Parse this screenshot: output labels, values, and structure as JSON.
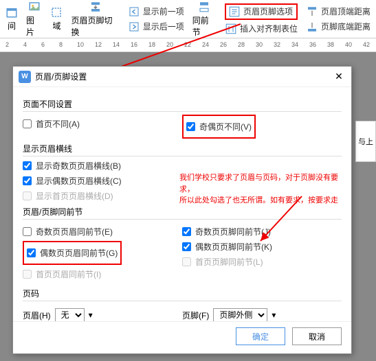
{
  "ribbon": {
    "g1": "间",
    "g2": "图片",
    "g3": "域",
    "g4": "页眉页脚切换",
    "g5a": "显示前一项",
    "g5b": "显示后一项",
    "g6": "同前节",
    "g7a": "页眉页脚选项",
    "g7b": "插入对齐制表位",
    "g8a": "页眉顶端距离",
    "g8b": "页脚底端距离"
  },
  "ruler": {
    "marks": [
      "2",
      "4",
      "6",
      "8",
      "10",
      "12",
      "14",
      "16",
      "18",
      "20",
      "22",
      "24",
      "26",
      "28",
      "30",
      "32",
      "34",
      "36",
      "38",
      "40",
      "42"
    ]
  },
  "side": "与上",
  "dialog": {
    "title": "页眉/页脚设置",
    "sec1": "页面不同设置",
    "chk_first": "首页不同(A)",
    "chk_oddeven": "奇偶页不同(V)",
    "sec2": "显示页眉横线",
    "chk_oddline": "显示奇数页页眉横线(B)",
    "chk_evenline": "显示偶数页页眉横线(C)",
    "chk_firstline": "显示首页页眉横线(D)",
    "sec3": "页眉/页脚同前节",
    "chk_e": "奇数页页眉同前节(E)",
    "chk_g": "偶数页页眉同前节(G)",
    "chk_i": "首页页眉同前节(I)",
    "chk_j": "奇数页页脚同前节(J)",
    "chk_k": "偶数页页脚同前节(K)",
    "chk_l": "首页页脚同前节(L)",
    "sec4": "页码",
    "header_lbl": "页眉(H)",
    "header_val": "无",
    "footer_lbl": "页脚(F)",
    "footer_val": "页脚外侧",
    "ok": "确定",
    "cancel": "取消"
  },
  "note": {
    "l1": "我们学校只要求了页眉与页码，对于页脚没有要求，",
    "l2": "所以此处勾选了也无所谓。如有要求，按要求走"
  }
}
